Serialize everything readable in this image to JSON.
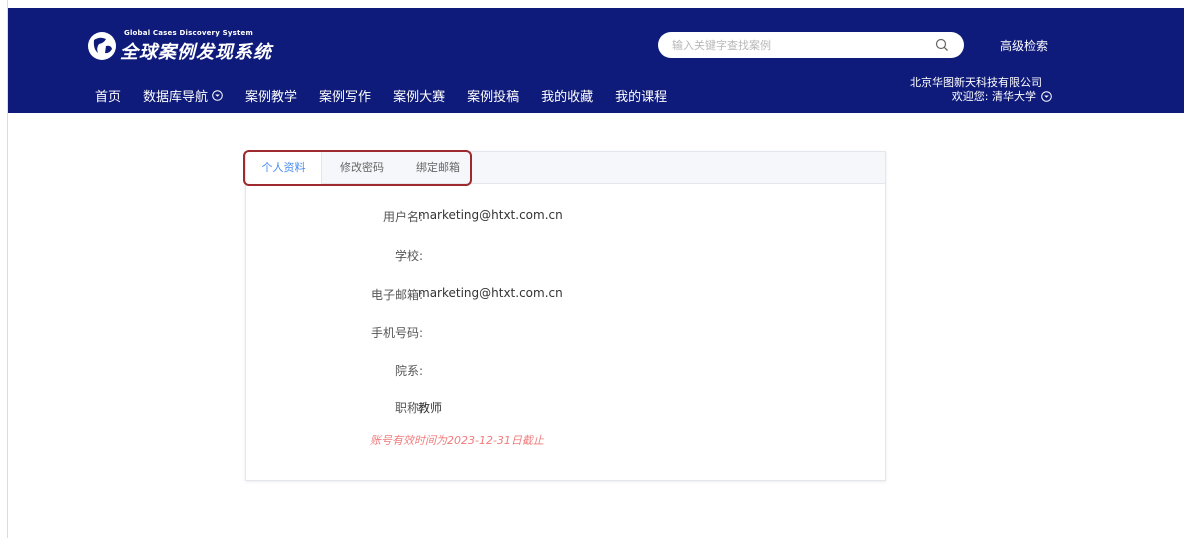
{
  "header": {
    "logo_en": "Global Cases Discovery System",
    "logo_cn": "全球案例发现系统",
    "search_placeholder": "输入关键字查找案例",
    "advanced_search": "高级检索",
    "company": "北京华图新天科技有限公司",
    "welcome": "欢迎您: 清华大学",
    "nav": [
      {
        "label": "首页",
        "has_dropdown": false
      },
      {
        "label": "数据库导航",
        "has_dropdown": true
      },
      {
        "label": "案例教学",
        "has_dropdown": false
      },
      {
        "label": "案例写作",
        "has_dropdown": false
      },
      {
        "label": "案例大赛",
        "has_dropdown": false
      },
      {
        "label": "案例投稿",
        "has_dropdown": false
      },
      {
        "label": "我的收藏",
        "has_dropdown": false
      },
      {
        "label": "我的课程",
        "has_dropdown": false
      }
    ]
  },
  "tabs": [
    {
      "label": "个人资料",
      "active": true
    },
    {
      "label": "修改密码",
      "active": false
    },
    {
      "label": "绑定邮箱",
      "active": false
    }
  ],
  "profile": {
    "username_label": "用户名:",
    "username_value": "marketing@htxt.com.cn",
    "school_label": "学校:",
    "school_value": "",
    "email_label": "电子邮箱:",
    "email_value": "marketing@htxt.com.cn",
    "phone_label": "手机号码:",
    "phone_value": "",
    "dept_label": "院系:",
    "dept_value": "",
    "title_label": "职称:",
    "title_value": "教师",
    "notice": "账号有效时间为2023-12-31日截止"
  },
  "colors": {
    "header_bg": "#0f1b7a",
    "tab_active": "#4a8df0",
    "highlight_border": "#9e2a2f",
    "notice": "#f07c7c"
  }
}
